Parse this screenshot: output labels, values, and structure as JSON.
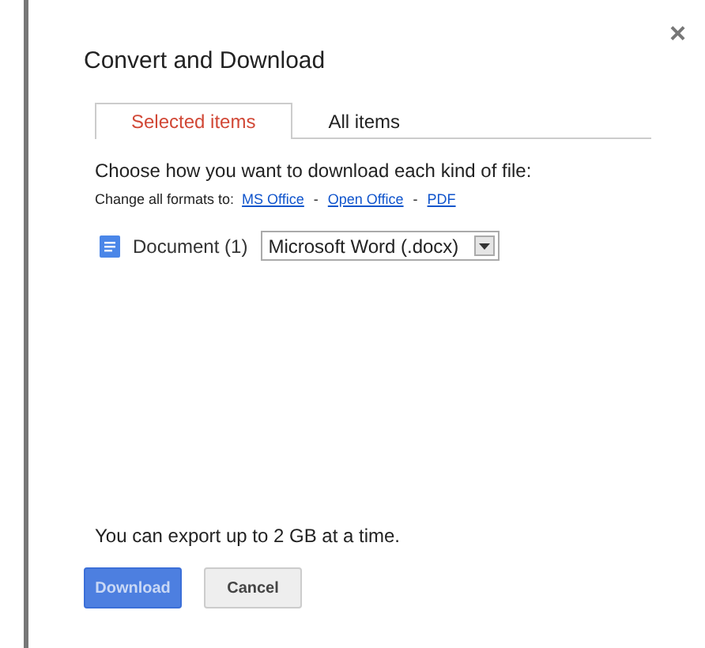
{
  "dialog": {
    "title": "Convert and Download",
    "close": "×"
  },
  "tabs": [
    {
      "label": "Selected items",
      "selected": true
    },
    {
      "label": "All items",
      "selected": false
    }
  ],
  "instruction": "Choose how you want to download each kind of file:",
  "change_all": {
    "label": "Change all formats to:",
    "links": [
      "MS Office",
      "Open Office",
      "PDF"
    ],
    "separator": "-"
  },
  "file_types": [
    {
      "name": "Document (1)",
      "format": "Microsoft Word (.docx)"
    }
  ],
  "note": "You can export up to 2 GB at a time.",
  "buttons": [
    {
      "label": "Download",
      "kind": "primary"
    },
    {
      "label": "Cancel",
      "kind": "secondary"
    }
  ]
}
